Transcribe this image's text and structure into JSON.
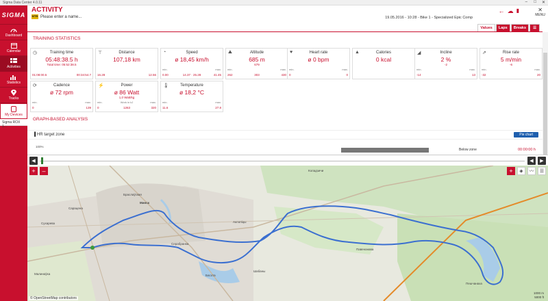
{
  "window": {
    "title": "Sigma Data Center 4.0.11"
  },
  "sidebar": {
    "logo": "SIGMA",
    "items": [
      {
        "label": "Dashboard",
        "icon": "gauge-icon"
      },
      {
        "label": "Calendar",
        "icon": "calendar-icon"
      },
      {
        "label": "Activities",
        "icon": "activities-icon"
      },
      {
        "label": "Statistics",
        "icon": "statistics-icon"
      },
      {
        "label": "Tracks",
        "icon": "tracks-icon"
      },
      {
        "label": "My Devices",
        "icon": "devices-icon"
      }
    ],
    "device": "Sigma ROX 1..."
  },
  "header": {
    "title": "ACTIVITY",
    "name_placeholder": "Please enter a name...",
    "badge": "MTB",
    "meta": "19.05.2016  -  10:28  -  Bike 1  -  Specialized Epic Comp",
    "menu_label": "MENU"
  },
  "tabs": [
    "Values",
    "Laps",
    "Breaks"
  ],
  "sections": {
    "training": "TRAINING STATISTICS",
    "graph": "GRAPH-BASED ANALYSIS"
  },
  "cards_row1": [
    {
      "label": "Training time",
      "value": "05:48:38.5 h",
      "sub": "Total time: 05:52:38.5",
      "min_label": "",
      "max_label": "",
      "min": "01:08:00.5",
      "max": "00:34:54.7",
      "icon": "stopwatch-icon"
    },
    {
      "label": "Distance",
      "value": "107,18 km",
      "sub": "",
      "min_label": "",
      "max_label": "",
      "min": "16.28",
      "max": "12.56",
      "icon": "distance-icon"
    },
    {
      "label": "Speed",
      "value": "ø 18,45 km/h",
      "sub": "",
      "min_label": "min.",
      "max_label": "max.",
      "min": "0.00",
      "mid": "14.37 · 25.28",
      "max": "41.45",
      "icon": "speedometer-icon"
    },
    {
      "label": "Altitude",
      "value": "685 m",
      "sub": "679",
      "min_label": "min.",
      "max_label": "max.",
      "min": "262",
      "mid": "303",
      "max": "430",
      "icon": "mountain-icon"
    },
    {
      "label": "Heart rate",
      "value": "ø 0 bpm",
      "sub": "",
      "min_label": "min.",
      "max_label": "max.",
      "min": "0",
      "max": "0",
      "icon": "heart-icon"
    },
    {
      "label": "Calories",
      "value": "0 kcal",
      "sub": "",
      "min_label": "",
      "max_label": "",
      "min": "",
      "max": "",
      "icon": "flame-icon"
    },
    {
      "label": "Incline",
      "value": "2 %",
      "sub": "-2",
      "min_label": "min.",
      "max_label": "max.",
      "min": "-14",
      "max": "13",
      "icon": "incline-icon"
    },
    {
      "label": "Rise rate",
      "value": "5 m/min",
      "sub": "-6",
      "min_label": "min.",
      "max_label": "max.",
      "min": "-32",
      "max": "20",
      "icon": "rise-icon"
    }
  ],
  "cards_row2": [
    {
      "label": "Cadence",
      "value": "ø 72 rpm",
      "sub": "",
      "min_label": "min.",
      "max_label": "max.",
      "min": "0",
      "max": "139",
      "icon": "cadence-icon"
    },
    {
      "label": "Power",
      "value": "ø 86 Watt",
      "sub": "1,0 Watt/kg",
      "min_label": "min.",
      "mid_label": "Work in kJ",
      "max_label": "max.",
      "min": "0",
      "mid": "1263",
      "max": "320",
      "icon": "power-icon"
    },
    {
      "label": "Temperature",
      "value": "ø 18,2 °C",
      "sub": "",
      "min_label": "min.",
      "max_label": "max.",
      "min": "11.6",
      "max": "27.8",
      "icon": "thermometer-icon"
    }
  ],
  "hr_zone": {
    "label": "HR target zone",
    "pie_button": "Pie chart",
    "percent": "100%",
    "below_zone": "Below zone",
    "time": "00:00:00 h"
  },
  "map": {
    "attribution": "© OpenStreetMap contributors",
    "scale": [
      "1000 m",
      "5000 ft"
    ],
    "places": [
      "Минск",
      "Сарацена",
      "Браслаўская",
      "Сухарева",
      "Малинаўка",
      "Серабранка",
      "Шабаны",
      "Коладзичи",
      "Павенанава",
      "Пешчанаха",
      "Аклопіцы",
      "Сарацена",
      "Басота"
    ]
  }
}
